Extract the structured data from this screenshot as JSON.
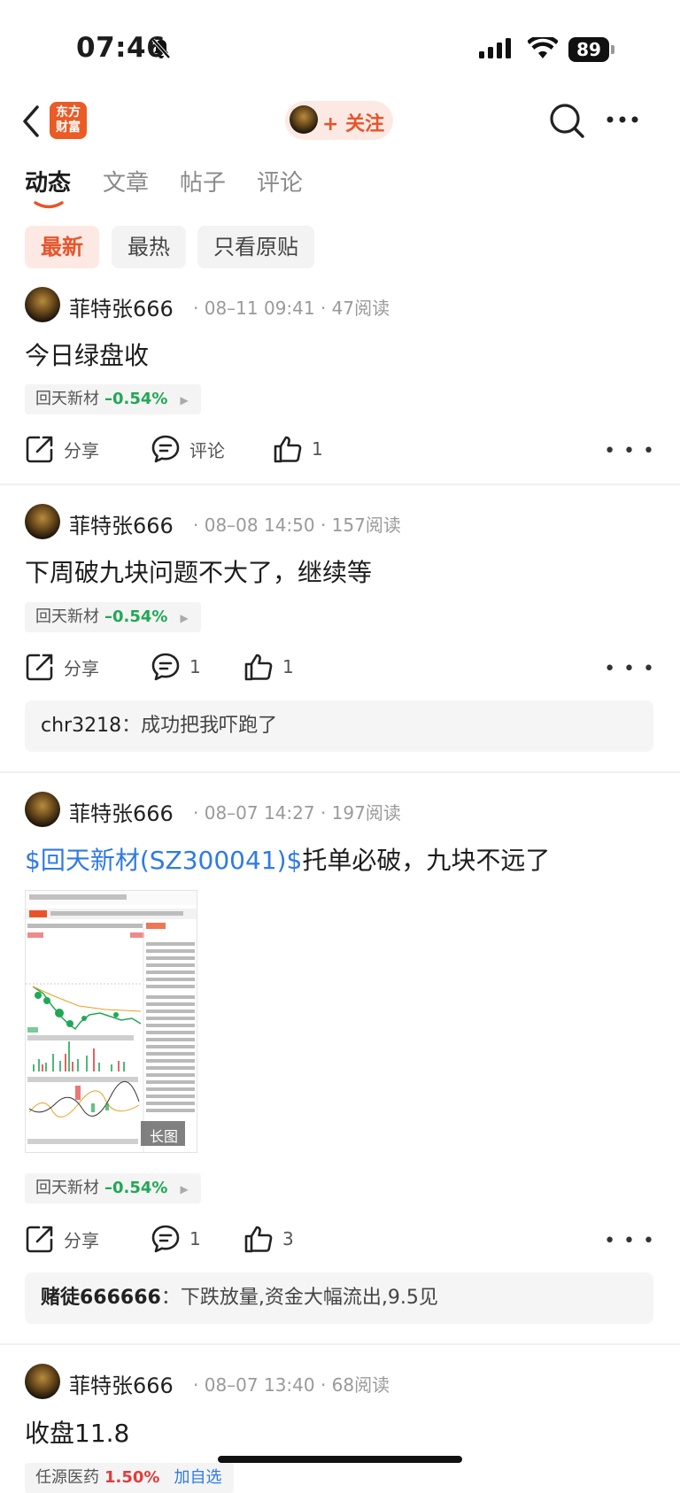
{
  "status_bar": {
    "time": "07:46",
    "battery": "89"
  },
  "header": {
    "back_icon": "chevron-left-icon",
    "brand_logo": "东方\n财富",
    "follow_label": "+ 关注",
    "search_icon": "search-icon",
    "more_icon": "more-icon"
  },
  "tabs": [
    {
      "label": "动态",
      "active": true
    },
    {
      "label": "文章",
      "active": false
    },
    {
      "label": "帖子",
      "active": false
    },
    {
      "label": "评论",
      "active": false
    }
  ],
  "filters": [
    {
      "label": "最新",
      "active": true
    },
    {
      "label": "最热",
      "active": false
    },
    {
      "label": "只看原贴",
      "active": false
    }
  ],
  "action_labels": {
    "share": "分享",
    "comment": "评论"
  },
  "posts": [
    {
      "author": "菲特张666",
      "meta": "· 08–11 09:41 · 47阅读",
      "text": "今日绿盘收",
      "stock": {
        "name": "回天新材",
        "change": "–0.54%"
      },
      "comments_count": "",
      "likes": "1"
    },
    {
      "author": "菲特张666",
      "meta": "· 08–08 14:50 · 157阅读",
      "text": "下周破九块问题不大了，继续等",
      "stock": {
        "name": "回天新材",
        "change": "–0.54%"
      },
      "comments_count": "1",
      "likes": "1",
      "top_comment": {
        "user": "chr3218",
        "text": "成功把我吓跑了"
      }
    },
    {
      "author": "菲特张666",
      "meta": "· 08–07 14:27 · 197阅读",
      "text_link": "$回天新材(SZ300041)$",
      "text": "托单必破，九块不远了",
      "image_badge": "长图",
      "stock": {
        "name": "回天新材",
        "change": "–0.54%"
      },
      "comments_count": "1",
      "likes": "3",
      "top_comment": {
        "user": "赌徒666666",
        "text": "下跌放量,资金大幅流出,9.5见"
      }
    },
    {
      "author": "菲特张666",
      "meta": "· 08–07 13:40 · 68阅读",
      "text": "收盘11.8",
      "stock": {
        "name": "任源医药",
        "change": "1.50%",
        "extra": "加自选"
      }
    }
  ],
  "colors": {
    "accent": "#e8542a",
    "down": "#21a854",
    "up": "#e23c3c",
    "link": "#2f7ae5"
  }
}
